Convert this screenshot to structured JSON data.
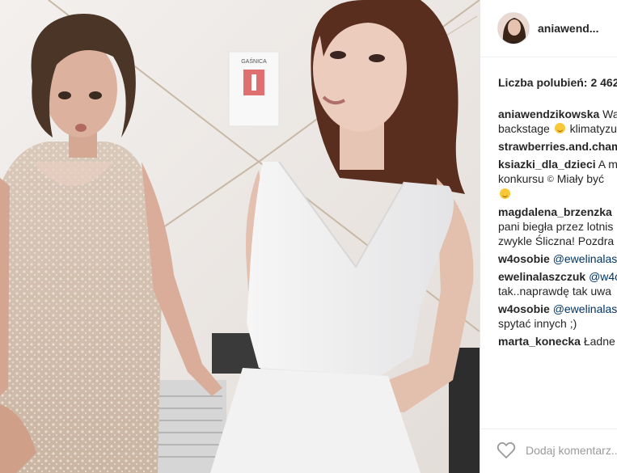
{
  "post": {
    "username": "aniawend...",
    "likes_label": "Liczba polubień:",
    "likes_count": "2 462",
    "photo_sign": "GAŚNICA"
  },
  "comments": [
    {
      "user": "aniawendzikowska",
      "lines": [
        "Wa",
        "backstage",
        "klimatyzu"
      ],
      "emoji_after_line": 1
    },
    {
      "user": "strawberries.and.cham",
      "lines": [
        ""
      ]
    },
    {
      "user": "ksiazki_dla_dzieci",
      "lines": [
        "A m",
        "konkursu",
        "Miały być",
        ""
      ]
    },
    {
      "user": "magdalena_brzenzka",
      "lines": [
        "",
        "pani biegła przez lotnis",
        "zwykle Śliczna! Pozdra"
      ]
    },
    {
      "user": "w4osobie",
      "mention": "@ewelinalas",
      "lines": [
        ""
      ]
    },
    {
      "user": "ewelinalaszczuk",
      "mention": "@w4o",
      "lines": [
        "",
        "tak..naprawdę tak uwa"
      ]
    },
    {
      "user": "w4osobie",
      "mention": "@ewelinalas",
      "lines": [
        "",
        "spytać innych ;)"
      ]
    },
    {
      "user": "marta_konecka",
      "lines": [
        "Ładne"
      ]
    }
  ],
  "footer": {
    "comment_placeholder": "Dodaj komentarz...",
    "like_icon": "heart-icon"
  },
  "colors": {
    "username": "#262626",
    "mention": "#003569",
    "placeholder": "#9a9a9a",
    "border": "#efefef"
  }
}
